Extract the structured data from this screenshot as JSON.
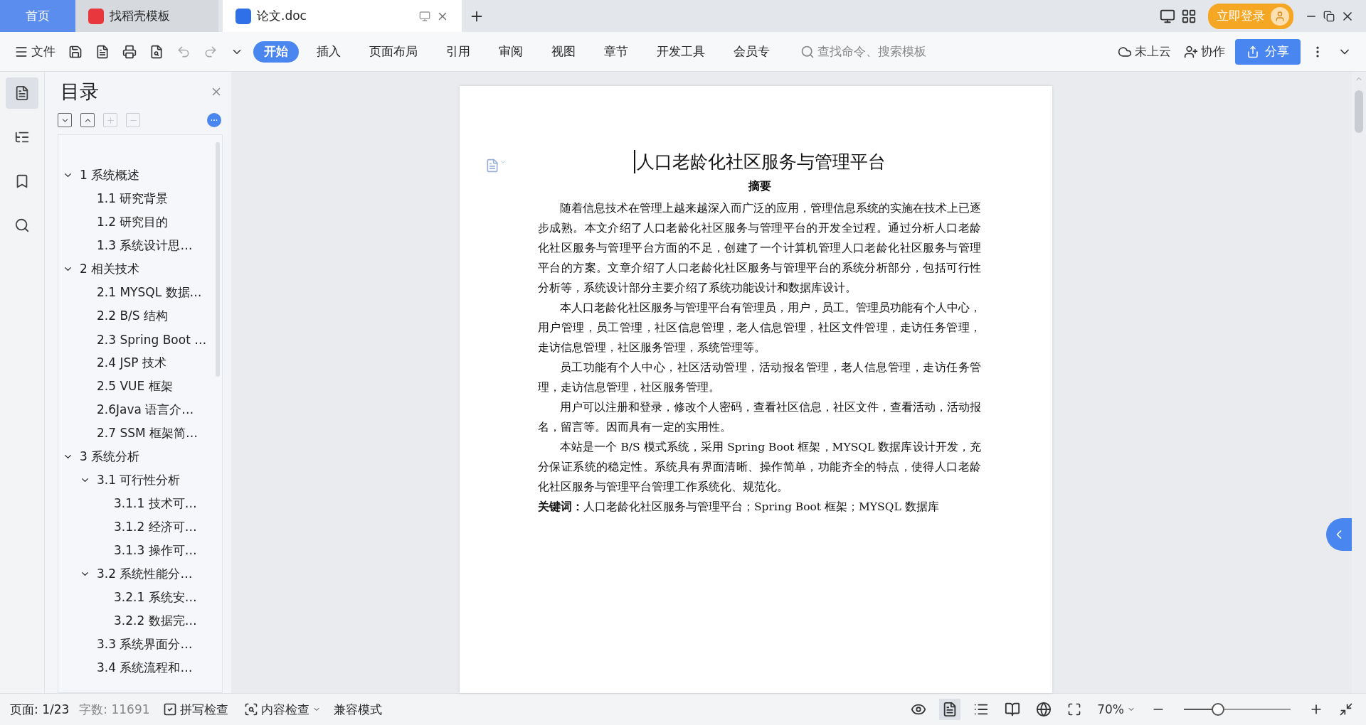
{
  "tabs": [
    {
      "label": "首页",
      "kind": "home",
      "selected": false
    },
    {
      "label": "找稻壳模板",
      "kind": "docer",
      "selected": false
    },
    {
      "label": "论文.doc",
      "kind": "doc",
      "selected": true
    }
  ],
  "login_button": "立即登录",
  "toolbar": {
    "file_menu": "文件",
    "ribbon_tabs": [
      {
        "label": "开始",
        "selected": true
      },
      {
        "label": "插入",
        "selected": false
      },
      {
        "label": "页面布局",
        "selected": false
      },
      {
        "label": "引用",
        "selected": false
      },
      {
        "label": "审阅",
        "selected": false
      },
      {
        "label": "视图",
        "selected": false
      },
      {
        "label": "章节",
        "selected": false
      },
      {
        "label": "开发工具",
        "selected": false
      },
      {
        "label": "会员专",
        "selected": false
      }
    ],
    "search": {
      "placeholder": "查找命令、搜索模板"
    },
    "cloud": "未上云",
    "collaborate": "协作",
    "share": "分享"
  },
  "toc": {
    "title": "目录",
    "items": [
      {
        "label": "1 系统概述",
        "expanded": true,
        "children": [
          {
            "label": "1.1  研究背景"
          },
          {
            "label": "1.2 研究目的"
          },
          {
            "label": "1.3 系统设计思…"
          }
        ]
      },
      {
        "label": "2 相关技术",
        "expanded": true,
        "children": [
          {
            "label": "2.1 MYSQL 数据…"
          },
          {
            "label": "2.2 B/S 结构"
          },
          {
            "label": "2.3 Spring Boot …"
          },
          {
            "label": "2.4 JSP 技术"
          },
          {
            "label": "2.5 VUE 框架"
          },
          {
            "label": "2.6Java 语言介…"
          },
          {
            "label": "2.7 SSM 框架简…"
          }
        ]
      },
      {
        "label": "3 系统分析",
        "expanded": true,
        "children": [
          {
            "label": "3.1 可行性分析",
            "expanded": true,
            "children": [
              {
                "label": "3.1.1 技术可…"
              },
              {
                "label": "3.1.2 经济可…"
              },
              {
                "label": "3.1.3 操作可…"
              }
            ]
          },
          {
            "label": "3.2 系统性能分…",
            "expanded": true,
            "children": [
              {
                "label": "3.2.1  系统安…"
              },
              {
                "label": "3.2.2  数据完…"
              }
            ]
          },
          {
            "label": "3.3 系统界面分…"
          },
          {
            "label": "3.4 系统流程和…"
          }
        ]
      }
    ]
  },
  "document": {
    "title": "人口老龄化社区服务与管理平台",
    "heading": "摘要",
    "paragraphs": [
      "随着信息技术在管理上越来越深入而广泛的应用，管理信息系统的实施在技术上已逐步成熟。本文介绍了人口老龄化社区服务与管理平台的开发全过程。通过分析人口老龄化社区服务与管理平台方面的不足，创建了一个计算机管理人口老龄化社区服务与管理平台的方案。文章介绍了人口老龄化社区服务与管理平台的系统分析部分，包括可行性分析等，系统设计部分主要介绍了系统功能设计和数据库设计。",
      "本人口老龄化社区服务与管理平台有管理员，用户，员工。管理员功能有个人中心，用户管理，员工管理，社区信息管理，老人信息管理，社区文件管理，走访任务管理，走访信息管理，社区服务管理，系统管理等。",
      "员工功能有个人中心，社区活动管理，活动报名管理，老人信息管理，走访任务管理，走访信息管理，社区服务管理。",
      "用户可以注册和登录，修改个人密码，查看社区信息，社区文件，查看活动，活动报名，留言等。因而具有一定的实用性。",
      "本站是一个 B/S 模式系统，采用 Spring Boot 框架，MYSQL 数据库设计开发，充分保证系统的稳定性。系统具有界面清晰、操作简单，功能齐全的特点，使得人口老龄化社区服务与管理平台管理工作系统化、规范化。"
    ],
    "keywords": "**关键词：**人口老龄化社区服务与管理平台；Spring Boot 框架；MYSQL 数据库"
  },
  "status_bar": {
    "page": "页面: 1/23",
    "word_count": "字数: 11691",
    "spell_check": "拼写检查",
    "content_check": "内容检查",
    "compat_mode": "兼容模式",
    "zoom": "70%",
    "zoom_slider": {
      "level": 0.32
    }
  }
}
